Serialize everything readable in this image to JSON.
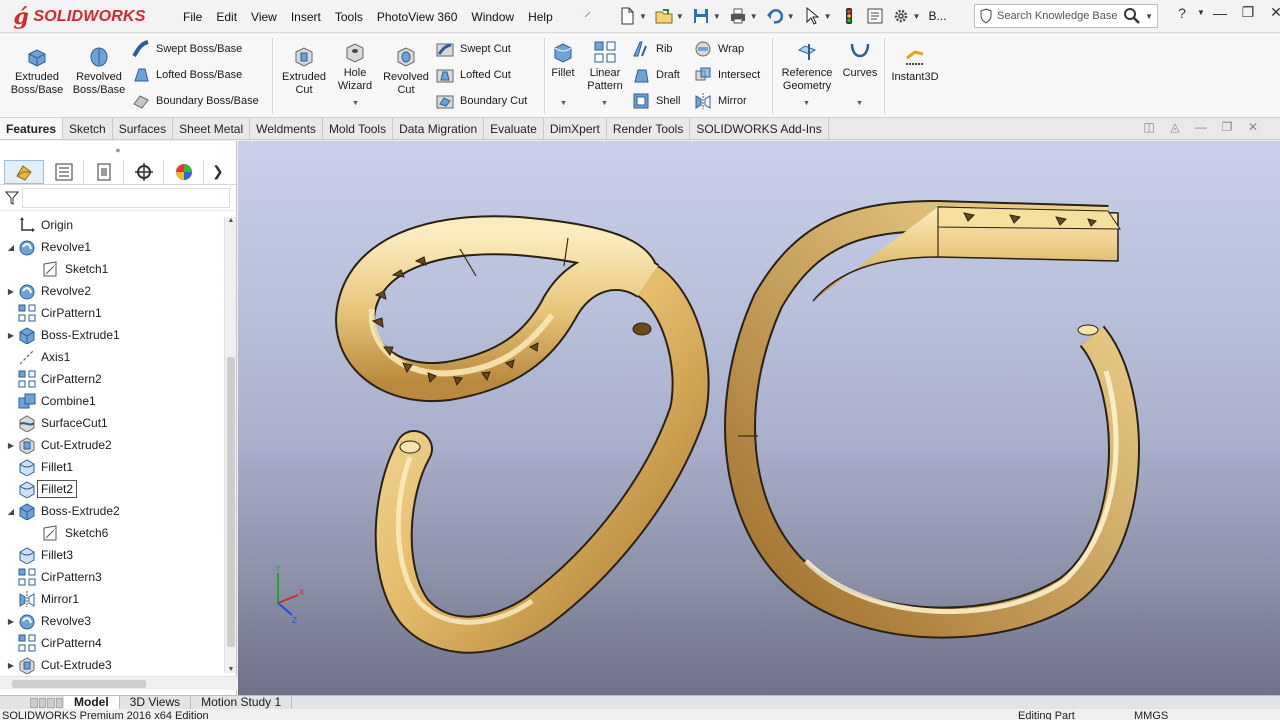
{
  "app": {
    "logo_text": "SOLIDWORKS",
    "menus": [
      "File",
      "Edit",
      "View",
      "Insert",
      "Tools",
      "PhotoView 360",
      "Window",
      "Help"
    ],
    "quick_overflow": "B...",
    "search_placeholder": "Search Knowledge Base"
  },
  "ribbon": {
    "extruded_boss": [
      "Extruded",
      "Boss/Base"
    ],
    "revolved_boss": [
      "Revolved",
      "Boss/Base"
    ],
    "swept_boss": "Swept Boss/Base",
    "lofted_boss": "Lofted Boss/Base",
    "boundary_boss": "Boundary Boss/Base",
    "extruded_cut": [
      "Extruded",
      "Cut"
    ],
    "hole_wizard": [
      "Hole",
      "Wizard"
    ],
    "revolved_cut": [
      "Revolved",
      "Cut"
    ],
    "swept_cut": "Swept Cut",
    "lofted_cut": "Lofted Cut",
    "boundary_cut": "Boundary Cut",
    "fillet": "Fillet",
    "linear_pattern": [
      "Linear",
      "Pattern"
    ],
    "rib": "Rib",
    "draft": "Draft",
    "shell": "Shell",
    "wrap": "Wrap",
    "intersect": "Intersect",
    "mirror": "Mirror",
    "reference_geometry": [
      "Reference",
      "Geometry"
    ],
    "curves": "Curves",
    "instant3d": "Instant3D"
  },
  "command_tabs": [
    "Features",
    "Sketch",
    "Surfaces",
    "Sheet Metal",
    "Weldments",
    "Mold Tools",
    "Data Migration",
    "Evaluate",
    "DimXpert",
    "Render Tools",
    "SOLIDWORKS Add-Ins"
  ],
  "feature_tree": [
    {
      "label": "Origin",
      "icon": "origin-icon",
      "expander": "",
      "indent": 0
    },
    {
      "label": "Revolve1",
      "icon": "revolve-icon",
      "expander": "expanded",
      "indent": 0
    },
    {
      "label": "Sketch1",
      "icon": "sketch-icon",
      "expander": "",
      "indent": 1
    },
    {
      "label": "Revolve2",
      "icon": "revolve-icon",
      "expander": "collapsed",
      "indent": 0
    },
    {
      "label": "CirPattern1",
      "icon": "pattern-icon",
      "expander": "",
      "indent": 0
    },
    {
      "label": "Boss-Extrude1",
      "icon": "extrude-icon",
      "expander": "collapsed",
      "indent": 0
    },
    {
      "label": "Axis1",
      "icon": "axis-icon",
      "expander": "",
      "indent": 0
    },
    {
      "label": "CirPattern2",
      "icon": "pattern-icon",
      "expander": "",
      "indent": 0
    },
    {
      "label": "Combine1",
      "icon": "combine-icon",
      "expander": "",
      "indent": 0
    },
    {
      "label": "SurfaceCut1",
      "icon": "surface-cut-icon",
      "expander": "",
      "indent": 0
    },
    {
      "label": "Cut-Extrude2",
      "icon": "cut-extrude-icon",
      "expander": "collapsed",
      "indent": 0
    },
    {
      "label": "Fillet1",
      "icon": "fillet-icon",
      "expander": "",
      "indent": 0
    },
    {
      "label": "Fillet2",
      "icon": "fillet-icon",
      "expander": "",
      "indent": 0,
      "selected": true
    },
    {
      "label": "Boss-Extrude2",
      "icon": "extrude-icon",
      "expander": "expanded",
      "indent": 0
    },
    {
      "label": "Sketch6",
      "icon": "sketch-icon",
      "expander": "",
      "indent": 1
    },
    {
      "label": "Fillet3",
      "icon": "fillet-icon",
      "expander": "",
      "indent": 0
    },
    {
      "label": "CirPattern3",
      "icon": "pattern-icon",
      "expander": "",
      "indent": 0
    },
    {
      "label": "Mirror1",
      "icon": "mirror-icon",
      "expander": "",
      "indent": 0
    },
    {
      "label": "Revolve3",
      "icon": "revolve-icon",
      "expander": "collapsed",
      "indent": 0
    },
    {
      "label": "CirPattern4",
      "icon": "pattern-icon",
      "expander": "",
      "indent": 0
    },
    {
      "label": "Cut-Extrude3",
      "icon": "cut-extrude-icon",
      "expander": "collapsed",
      "indent": 0
    }
  ],
  "triad": {
    "x": "X",
    "y": "Y",
    "z": "Z"
  },
  "bottom_tabs": [
    "Model",
    "3D Views",
    "Motion Study 1"
  ],
  "status": {
    "product": "SOLIDWORKS Premium 2016 x64 Edition",
    "mode": "Editing Part",
    "units": "MMGS"
  },
  "colors": {
    "brand": "#d8262a",
    "gold": "#e9c677",
    "gold_dark": "#b8873a",
    "viewport_top": "#c9cfe9",
    "viewport_bottom": "#6f7189"
  }
}
